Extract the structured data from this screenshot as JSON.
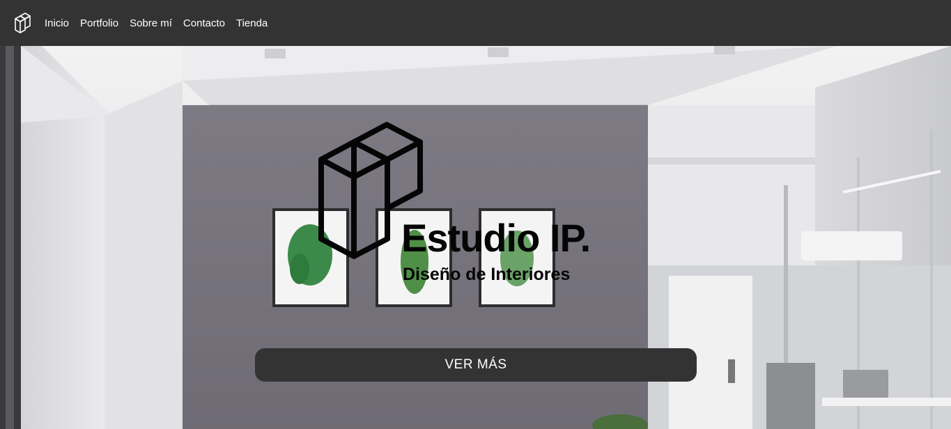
{
  "nav": {
    "logo_icon": "cube-logo-icon",
    "links": [
      "Inicio",
      "Portfolio",
      "Sobre mí",
      "Contacto",
      "Tienda"
    ]
  },
  "hero": {
    "brand_name": "Estudio IP.",
    "brand_tagline": "Diseño de Interiores",
    "logo_icon": "cube-logo-icon",
    "cta_label": "VER MÁS"
  },
  "colors": {
    "navbar": "#333333",
    "button": "#333333",
    "text_light": "#ffffff",
    "brand_dark": "#050505",
    "feature_wall": "#76737d",
    "white_walls": "#e4e4e6"
  }
}
